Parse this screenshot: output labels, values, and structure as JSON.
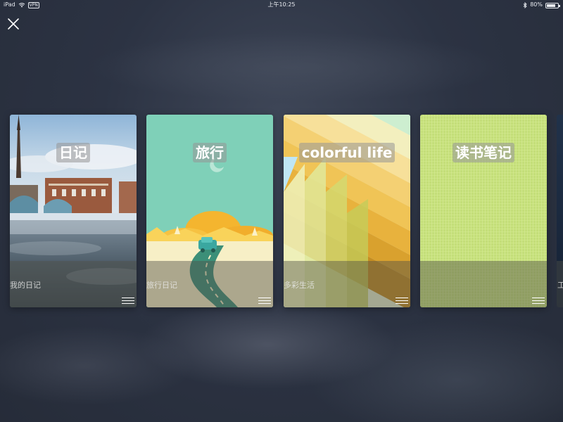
{
  "status_bar": {
    "device": "iPad",
    "vpn": "VPN",
    "time": "上午10:25",
    "battery": "80%"
  },
  "toolbar": {
    "close_icon": "close-icon"
  },
  "cards": [
    {
      "title": "日记",
      "subtitle": "我的日记",
      "theme": "city-harbor-photo"
    },
    {
      "title": "旅行",
      "subtitle": "旅行日记",
      "theme": "road-trip-illustration"
    },
    {
      "title": "colorful life",
      "subtitle": "多彩生活",
      "theme": "rainbow-stripes"
    },
    {
      "title": "读书笔记",
      "subtitle": "",
      "theme": "green-linen"
    }
  ],
  "partial_card": {
    "subtitle": "工"
  },
  "colors": {
    "background": "#2c3343",
    "card2_bg": "#7fd0b8",
    "card4_bg": "#c6e07a"
  }
}
